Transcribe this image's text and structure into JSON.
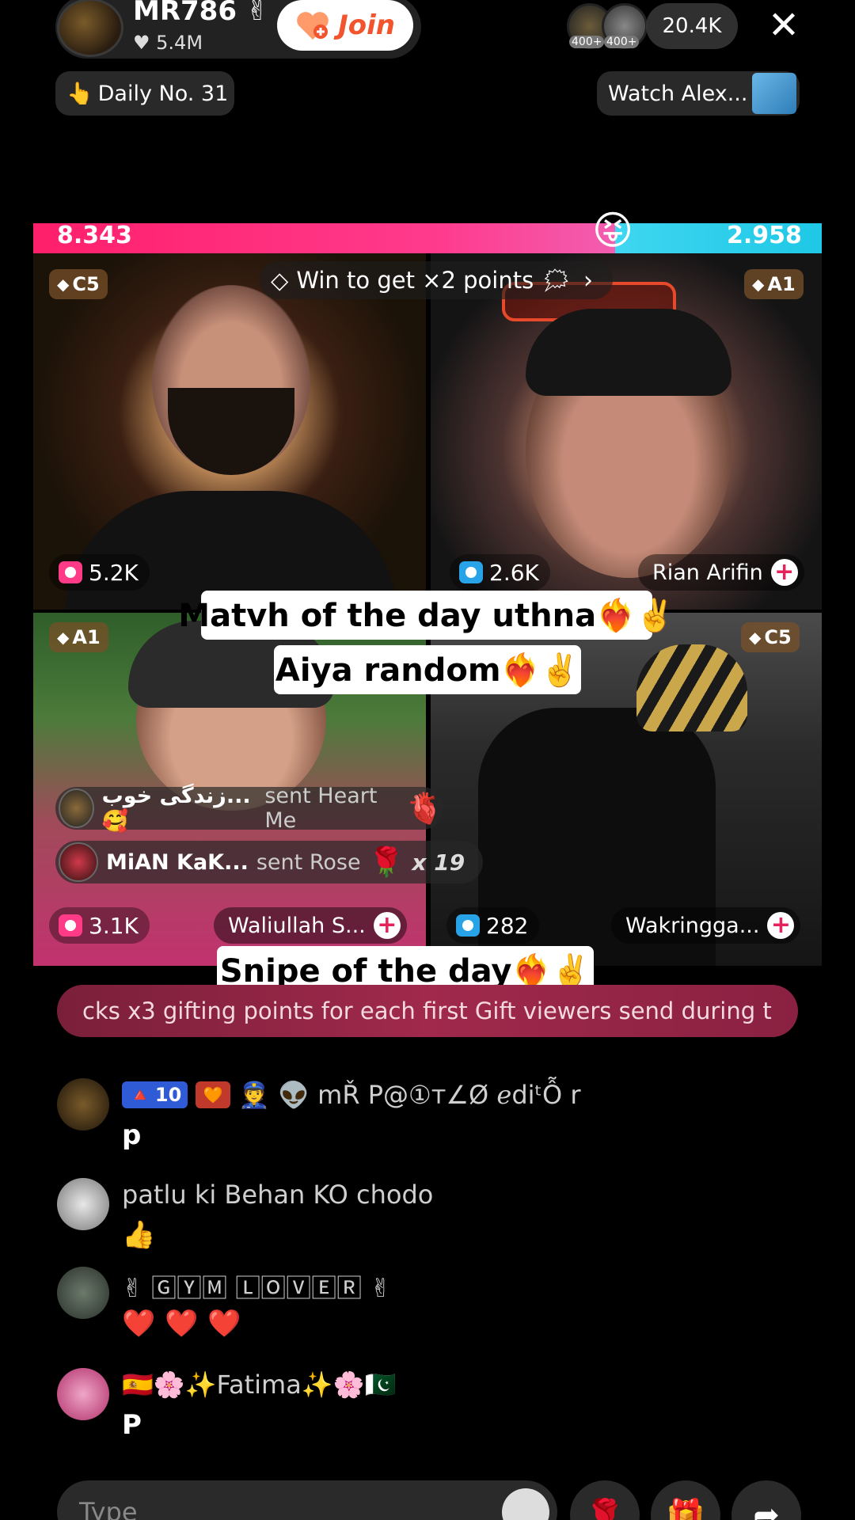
{
  "host": {
    "name": "MR786",
    "name_emoji": "✌",
    "likes": "5.4M",
    "join_label": "Join"
  },
  "viewers": {
    "badge1": "400+",
    "badge2": "400+",
    "count": "20.4K"
  },
  "daily": {
    "label": "Daily No. 31",
    "icon": "👆"
  },
  "watch": {
    "label": "Watch Alex..."
  },
  "battle": {
    "score_left": "8.343",
    "score_right": "2.958",
    "left_share": 0.738,
    "emoji": "😝",
    "banner": "Win to get ×2 points",
    "banner_emoji": "🗯"
  },
  "cells": {
    "tl": {
      "rank": "C5",
      "likes": "5.2K"
    },
    "tr": {
      "rank": "A1",
      "likes": "2.6K",
      "name": "Rian Arifin"
    },
    "bl": {
      "rank": "A1",
      "likes": "3.1K",
      "name": "Waliullah S..."
    },
    "br": {
      "rank": "C5",
      "likes": "282",
      "name": "Wakringga..."
    }
  },
  "captions": {
    "c1": "Matvh of the day uthna❤️‍🔥✌️",
    "c2": "Aiya random❤️‍🔥✌️",
    "c3": "Snipe of the day❤️‍🔥✌️"
  },
  "gifts": [
    {
      "name": "زندگی خوب...🥰",
      "text": "sent Heart Me",
      "emoji": "🥰",
      "combo": ""
    },
    {
      "name": "MiAN KaK...",
      "text": "sent Rose",
      "emoji": "🌹",
      "combo": "x 19"
    }
  ],
  "ticker": "cks x3 gifting points for each first Gift viewers send during t",
  "comments": [
    {
      "level": "10",
      "level_icon": "🔺",
      "emojis": "👮 👽",
      "user": "mŘ P@①ᴛ∠Ø ℯdiᵗỖ r",
      "text": "p"
    },
    {
      "user": "patlu ki Behan KO chodo",
      "text": "👍"
    },
    {
      "user": "✌ 🄶🅈🄼 🄻🄾🅅🄴🅁 ✌",
      "text": "❤️ ❤️ ❤️"
    },
    {
      "user": "🇪🇸🌸✨Fatima✨🌸🇵🇰",
      "text": "P"
    }
  ],
  "input": {
    "placeholder": "Type"
  },
  "buttons": {
    "rose": "🌹",
    "gift": "🎁",
    "share": "➦"
  },
  "colors": {
    "battle_left": "#ff1f6b",
    "battle_right": "#1ec8e6",
    "join_text": "#f2542d",
    "ticker_bg": "#a0294c"
  }
}
